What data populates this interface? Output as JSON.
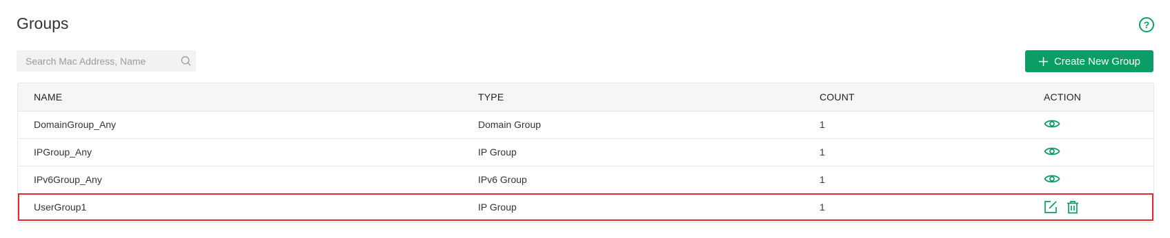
{
  "page": {
    "title": "Groups",
    "help_icon": "question-circle-icon"
  },
  "search": {
    "placeholder": "Search Mac Address, Name",
    "value": ""
  },
  "toolbar": {
    "create_label": "Create New Group"
  },
  "table": {
    "columns": [
      "NAME",
      "TYPE",
      "COUNT",
      "ACTION"
    ],
    "rows": [
      {
        "name": "DomainGroup_Any",
        "type": "Domain Group",
        "count": "1",
        "actions": [
          "view-icon"
        ]
      },
      {
        "name": "IPGroup_Any",
        "type": "IP Group",
        "count": "1",
        "actions": [
          "view-icon"
        ]
      },
      {
        "name": "IPv6Group_Any",
        "type": "IPv6 Group",
        "count": "1",
        "actions": [
          "view-icon"
        ]
      },
      {
        "name": "UserGroup1",
        "type": "IP Group",
        "count": "1",
        "actions": [
          "edit-icon",
          "delete-icon"
        ],
        "highlighted": true
      }
    ]
  },
  "colors": {
    "accent": "#0a9d66",
    "highlight": "#e0282e",
    "header_bg": "#f6f6f6",
    "border": "#e6e6e6"
  }
}
